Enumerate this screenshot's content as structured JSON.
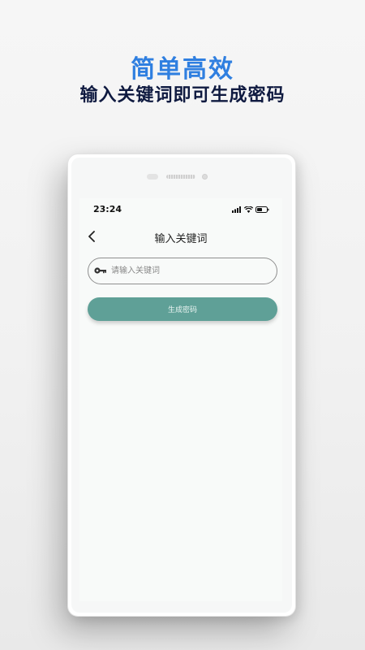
{
  "promo": {
    "title": "简单高效",
    "subtitle": "输入关键词即可生成密码"
  },
  "status_bar": {
    "time": "23:24",
    "icons": [
      "signal-icon",
      "wifi-icon",
      "battery-icon"
    ]
  },
  "header": {
    "title": "输入关键词",
    "back_icon": "chevron-left-icon"
  },
  "search": {
    "placeholder": "请输入关键词",
    "value": "",
    "icon": "key-icon"
  },
  "generate_button": {
    "label": "生成密码"
  },
  "colors": {
    "promo_title": "#2f7fe0",
    "promo_subtitle": "#0f1a40",
    "button_bg": "#5fa097",
    "screen_bg": "#f8faf9"
  }
}
